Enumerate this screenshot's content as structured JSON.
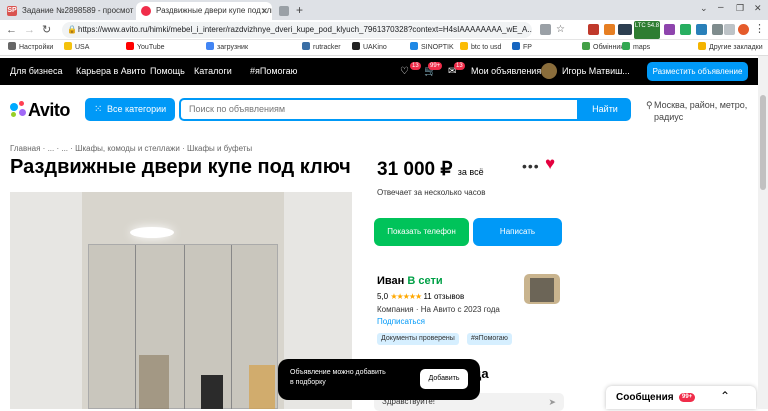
{
  "browser": {
    "tabs": [
      {
        "label": "Задание №2898589 - просмотр з",
        "fav": "SP",
        "fav_color": "#d9534f"
      },
      {
        "label": "Раздвижные двери купе под клю",
        "fav": "",
        "fav_color": "#f02d4a"
      },
      {
        "label": "",
        "fav": "",
        "fav_color": "#9aa0a6"
      }
    ],
    "url": "https://www.avito.ru/himki/mebel_i_interer/razdvizhnye_dveri_kupe_pod_klyuch_7961370328?context=H4sIAAAAAAAA_wE_A...",
    "ext_text": "LTC 54.8",
    "bookmarks": [
      "Настройки",
      "USA",
      "YouTube",
      "загрузник",
      "rutracker",
      "UAKino",
      "SINOPTIK",
      "btc to usd",
      "FP",
      "Обмінник",
      "maps",
      "Другие закладки"
    ]
  },
  "topnav": {
    "items": [
      "Для бизнеса",
      "Карьера в Авито",
      "Помощь",
      "Каталоги",
      "#яПомогаю"
    ],
    "badges": [
      "13",
      "99+",
      "13"
    ],
    "my_ads": "Мои объявления",
    "user": "Игорь Матвиш...",
    "post_button": "Разместить объявление"
  },
  "header": {
    "logo": "Avito",
    "categories_button": "Все категории",
    "search_placeholder": "Поиск по объявлениям",
    "find_button": "Найти",
    "location": "Москва, район, метро, радиус"
  },
  "breadcrumbs": [
    "Главная",
    "...",
    "...",
    "Шкафы, комоды и стеллажи",
    "Шкафы и буфеты"
  ],
  "listing": {
    "title": "Раздвижные двери купе под ключ",
    "price": "31 000 ₽",
    "price_note": "за всё",
    "response": "Отвечает за несколько часов",
    "show_phone": "Показать телефон",
    "write": "Написать"
  },
  "seller": {
    "name": "Иван",
    "status": "В сети",
    "rating": "5,0",
    "stars": "★★★★★",
    "reviews": "11 отзывов",
    "company": "Компания · На Авито с 2023 года",
    "subscribe": "Подписаться",
    "tags": [
      "Документы проверены",
      "#яПомогаю"
    ]
  },
  "ask": {
    "heading": "авца",
    "message": "Здравствуйте!"
  },
  "toast": {
    "line1": "Объявление можно добавить",
    "line2": "в подборку",
    "button": "Добавить"
  },
  "messages": {
    "label": "Сообщения",
    "badge": "99+"
  },
  "colors": {
    "accent": "#0099f7",
    "green": "#00c35a",
    "heart": "#e4003e"
  }
}
